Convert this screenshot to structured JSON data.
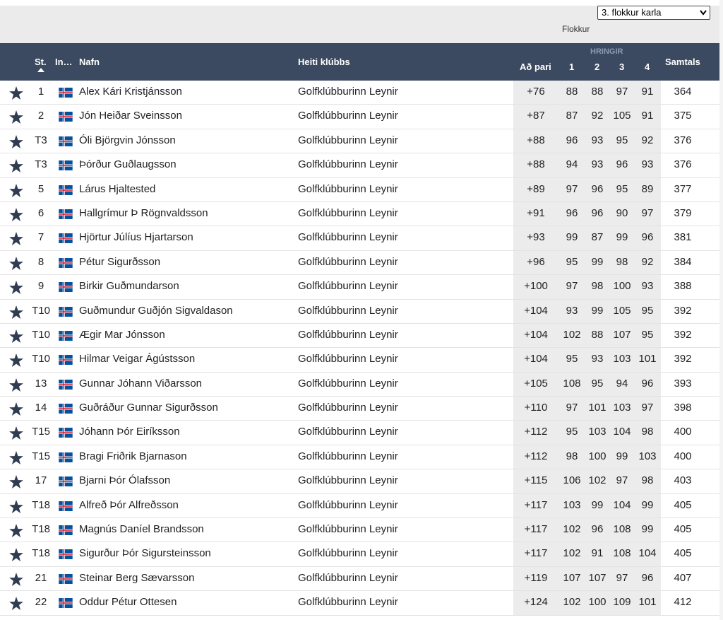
{
  "filter": {
    "selected": "3. flokkur karla",
    "label": "Flokkur"
  },
  "header": {
    "position": "St.",
    "initials": "In…",
    "name": "Nafn",
    "club": "Heiti klúbbs",
    "to_par": "Að pari",
    "rounds_group": "HRINGIR",
    "r1": "1",
    "r2": "2",
    "r3": "3",
    "r4": "4",
    "total": "Samtals"
  },
  "flag_colors": {
    "blue": "#02529c",
    "white": "#ffffff",
    "red": "#dc1e35"
  },
  "players": [
    {
      "pos": "1",
      "name": "Alex Kári Kristjánsson",
      "club": "Golfklúbburinn Leynir",
      "par": "+76",
      "r1": "88",
      "r2": "88",
      "r3": "97",
      "r4": "91",
      "total": "364"
    },
    {
      "pos": "2",
      "name": "Jón Heiðar Sveinsson",
      "club": "Golfklúbburinn Leynir",
      "par": "+87",
      "r1": "87",
      "r2": "92",
      "r3": "105",
      "r4": "91",
      "total": "375"
    },
    {
      "pos": "T3",
      "name": "Óli Björgvin Jónsson",
      "club": "Golfklúbburinn Leynir",
      "par": "+88",
      "r1": "96",
      "r2": "93",
      "r3": "95",
      "r4": "92",
      "total": "376"
    },
    {
      "pos": "T3",
      "name": "Þórður Guðlaugsson",
      "club": "Golfklúbburinn Leynir",
      "par": "+88",
      "r1": "94",
      "r2": "93",
      "r3": "96",
      "r4": "93",
      "total": "376"
    },
    {
      "pos": "5",
      "name": "Lárus Hjaltested",
      "club": "Golfklúbburinn Leynir",
      "par": "+89",
      "r1": "97",
      "r2": "96",
      "r3": "95",
      "r4": "89",
      "total": "377"
    },
    {
      "pos": "6",
      "name": "Hallgrímur Þ Rögnvaldsson",
      "club": "Golfklúbburinn Leynir",
      "par": "+91",
      "r1": "96",
      "r2": "96",
      "r3": "90",
      "r4": "97",
      "total": "379"
    },
    {
      "pos": "7",
      "name": "Hjörtur Júlíus Hjartarson",
      "club": "Golfklúbburinn Leynir",
      "par": "+93",
      "r1": "99",
      "r2": "87",
      "r3": "99",
      "r4": "96",
      "total": "381"
    },
    {
      "pos": "8",
      "name": "Pétur Sigurðsson",
      "club": "Golfklúbburinn Leynir",
      "par": "+96",
      "r1": "95",
      "r2": "99",
      "r3": "98",
      "r4": "92",
      "total": "384"
    },
    {
      "pos": "9",
      "name": "Birkir Guðmundarson",
      "club": "Golfklúbburinn Leynir",
      "par": "+100",
      "r1": "97",
      "r2": "98",
      "r3": "100",
      "r4": "93",
      "total": "388"
    },
    {
      "pos": "T10",
      "name": "Guðmundur Guðjón Sigvaldason",
      "club": "Golfklúbburinn Leynir",
      "par": "+104",
      "r1": "93",
      "r2": "99",
      "r3": "105",
      "r4": "95",
      "total": "392"
    },
    {
      "pos": "T10",
      "name": "Ægir Mar Jónsson",
      "club": "Golfklúbburinn Leynir",
      "par": "+104",
      "r1": "102",
      "r2": "88",
      "r3": "107",
      "r4": "95",
      "total": "392"
    },
    {
      "pos": "T10",
      "name": "Hilmar Veigar Ágústsson",
      "club": "Golfklúbburinn Leynir",
      "par": "+104",
      "r1": "95",
      "r2": "93",
      "r3": "103",
      "r4": "101",
      "total": "392"
    },
    {
      "pos": "13",
      "name": "Gunnar Jóhann Viðarsson",
      "club": "Golfklúbburinn Leynir",
      "par": "+105",
      "r1": "108",
      "r2": "95",
      "r3": "94",
      "r4": "96",
      "total": "393"
    },
    {
      "pos": "14",
      "name": "Guðráður Gunnar Sigurðsson",
      "club": "Golfklúbburinn Leynir",
      "par": "+110",
      "r1": "97",
      "r2": "101",
      "r3": "103",
      "r4": "97",
      "total": "398"
    },
    {
      "pos": "T15",
      "name": "Jóhann Þór Eiríksson",
      "club": "Golfklúbburinn Leynir",
      "par": "+112",
      "r1": "95",
      "r2": "103",
      "r3": "104",
      "r4": "98",
      "total": "400"
    },
    {
      "pos": "T15",
      "name": "Bragi Friðrik Bjarnason",
      "club": "Golfklúbburinn Leynir",
      "par": "+112",
      "r1": "98",
      "r2": "100",
      "r3": "99",
      "r4": "103",
      "total": "400"
    },
    {
      "pos": "17",
      "name": "Bjarni Þór Ólafsson",
      "club": "Golfklúbburinn Leynir",
      "par": "+115",
      "r1": "106",
      "r2": "102",
      "r3": "97",
      "r4": "98",
      "total": "403"
    },
    {
      "pos": "T18",
      "name": "Alfreð Þór Alfreðsson",
      "club": "Golfklúbburinn Leynir",
      "par": "+117",
      "r1": "103",
      "r2": "99",
      "r3": "104",
      "r4": "99",
      "total": "405"
    },
    {
      "pos": "T18",
      "name": "Magnús Daníel Brandsson",
      "club": "Golfklúbburinn Leynir",
      "par": "+117",
      "r1": "102",
      "r2": "96",
      "r3": "108",
      "r4": "99",
      "total": "405"
    },
    {
      "pos": "T18",
      "name": "Sigurður Þór Sigursteinsson",
      "club": "Golfklúbburinn Leynir",
      "par": "+117",
      "r1": "102",
      "r2": "91",
      "r3": "108",
      "r4": "104",
      "total": "405"
    },
    {
      "pos": "21",
      "name": "Steinar Berg Sævarsson",
      "club": "Golfklúbburinn Leynir",
      "par": "+119",
      "r1": "107",
      "r2": "107",
      "r3": "97",
      "r4": "96",
      "total": "407"
    },
    {
      "pos": "22",
      "name": "Oddur Pétur Ottesen",
      "club": "Golfklúbburinn Leynir",
      "par": "+124",
      "r1": "102",
      "r2": "100",
      "r3": "109",
      "r4": "101",
      "total": "412"
    }
  ]
}
